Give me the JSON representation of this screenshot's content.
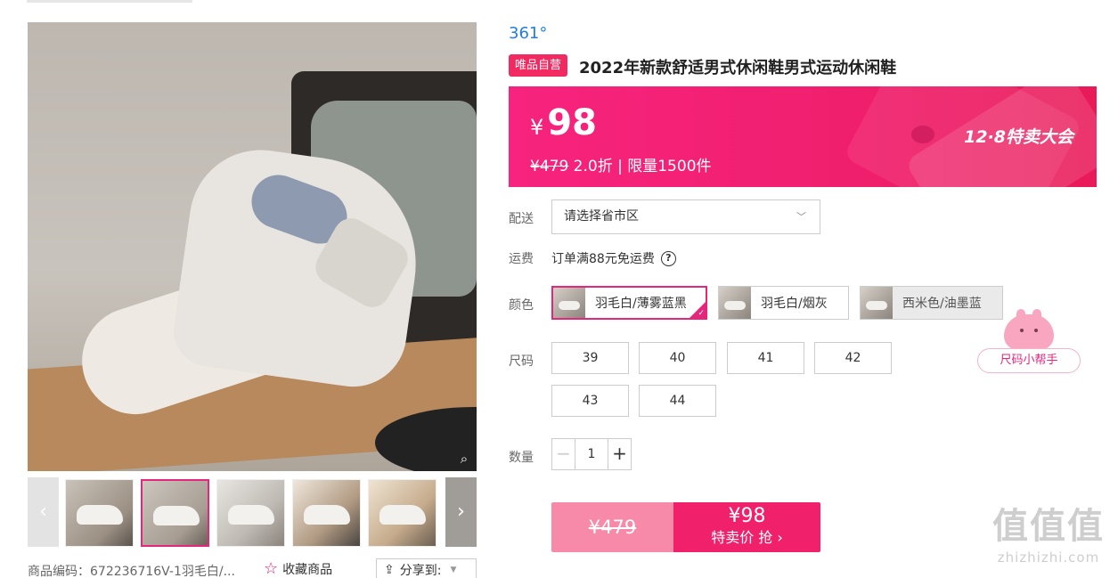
{
  "product": {
    "brand": "361°",
    "self_tag": "唯品自营",
    "title": "2022年新款舒适男式休闲鞋男式运动休闲鞋"
  },
  "price_banner": {
    "currency": "¥",
    "price": "98",
    "original_price": "¥479",
    "discount_info": "2.0折 | 限量1500件",
    "event_name": "12·8特卖大会"
  },
  "delivery": {
    "label": "配送",
    "region_placeholder": "请选择省市区"
  },
  "shipping": {
    "label": "运费",
    "text": "订单满88元免运费"
  },
  "colors": {
    "label": "颜色",
    "options": [
      {
        "label": "羽毛白/薄雾蓝黑",
        "state": "selected"
      },
      {
        "label": "羽毛白/烟灰",
        "state": "available"
      },
      {
        "label": "西米色/油墨蓝",
        "state": "disabled"
      }
    ]
  },
  "sizes": {
    "label": "尺码",
    "options": [
      "39",
      "40",
      "41",
      "42",
      "43",
      "44"
    ],
    "helper_label": "尺码小帮手"
  },
  "quantity": {
    "label": "数量",
    "value": "1",
    "minus": "−",
    "plus": "+"
  },
  "buy": {
    "original_price": "¥479",
    "price": "¥98",
    "action_label": "特卖价 抢 ›"
  },
  "gallery": {
    "prev": "‹",
    "next": "›",
    "zoom": "⌕",
    "thumbnail_count": 5,
    "active_index": 1
  },
  "footer": {
    "sku": "商品编码：672236716V-1羽毛白/...",
    "favorite": "收藏商品",
    "share": "分享到:"
  },
  "watermark": {
    "glyphs": "值值值",
    "site": "zhizhizhi.com"
  },
  "colors_theme": {
    "accent": "#f0216a",
    "brand_blue": "#1f7ee0",
    "selected_border": "#e4267d"
  }
}
